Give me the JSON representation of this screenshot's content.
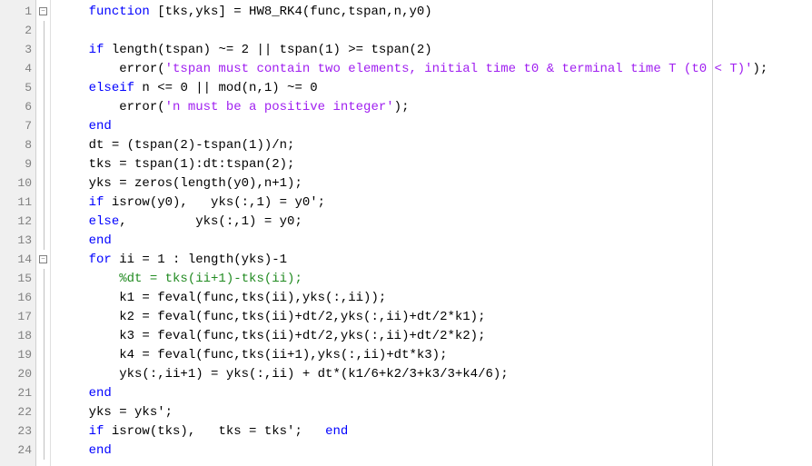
{
  "line_numbers": [
    "1",
    "2",
    "3",
    "4",
    "5",
    "6",
    "7",
    "8",
    "9",
    "10",
    "11",
    "12",
    "13",
    "14",
    "15",
    "16",
    "17",
    "18",
    "19",
    "20",
    "21",
    "22",
    "23",
    "24"
  ],
  "fold_markers": {
    "0": "minus",
    "13": "minus"
  },
  "code": [
    [
      {
        "c": "kw",
        "t": "function"
      },
      {
        "c": "txt",
        "t": " [tks,yks] = HW8_RK4(func,tspan,n,y0)"
      }
    ],
    [],
    [
      {
        "c": "kw",
        "t": "if"
      },
      {
        "c": "txt",
        "t": " length(tspan) ~= 2 || tspan(1) >= tspan(2)"
      }
    ],
    [
      {
        "c": "txt",
        "t": "    error("
      },
      {
        "c": "str",
        "t": "'tspan must contain two elements, initial time t0 & terminal time T (t0 < T)'"
      },
      {
        "c": "txt",
        "t": ");"
      }
    ],
    [
      {
        "c": "kw",
        "t": "elseif"
      },
      {
        "c": "txt",
        "t": " n <= 0 || mod(n,1) ~= 0"
      }
    ],
    [
      {
        "c": "txt",
        "t": "    error("
      },
      {
        "c": "str",
        "t": "'n must be a positive integer'"
      },
      {
        "c": "txt",
        "t": ");"
      }
    ],
    [
      {
        "c": "kw",
        "t": "end"
      }
    ],
    [
      {
        "c": "txt",
        "t": "dt = (tspan(2)-tspan(1))/n;"
      }
    ],
    [
      {
        "c": "txt",
        "t": "tks = tspan(1):dt:tspan(2);"
      }
    ],
    [
      {
        "c": "txt",
        "t": "yks = zeros(length(y0),n+1);"
      }
    ],
    [
      {
        "c": "kw",
        "t": "if"
      },
      {
        "c": "txt",
        "t": " isrow(y0),   yks(:,1) = y0';"
      }
    ],
    [
      {
        "c": "kw",
        "t": "else"
      },
      {
        "c": "txt",
        "t": ",         yks(:,1) = y0;"
      }
    ],
    [
      {
        "c": "kw",
        "t": "end"
      }
    ],
    [
      {
        "c": "kw",
        "t": "for"
      },
      {
        "c": "txt",
        "t": " ii = 1 : length(yks)-1"
      }
    ],
    [
      {
        "c": "txt",
        "t": "    "
      },
      {
        "c": "cmt",
        "t": "%dt = tks(ii+1)-tks(ii);"
      }
    ],
    [
      {
        "c": "txt",
        "t": "    k1 = feval(func,tks(ii),yks(:,ii));"
      }
    ],
    [
      {
        "c": "txt",
        "t": "    k2 = feval(func,tks(ii)+dt/2,yks(:,ii)+dt/2*k1);"
      }
    ],
    [
      {
        "c": "txt",
        "t": "    k3 = feval(func,tks(ii)+dt/2,yks(:,ii)+dt/2*k2);"
      }
    ],
    [
      {
        "c": "txt",
        "t": "    k4 = feval(func,tks(ii+1),yks(:,ii)+dt*k3);"
      }
    ],
    [
      {
        "c": "txt",
        "t": "    yks(:,ii+1) = yks(:,ii) + dt*(k1/6+k2/3+k3/3+k4/6);"
      }
    ],
    [
      {
        "c": "kw",
        "t": "end"
      }
    ],
    [
      {
        "c": "txt",
        "t": "yks = yks';"
      }
    ],
    [
      {
        "c": "kw",
        "t": "if"
      },
      {
        "c": "txt",
        "t": " isrow(tks),   tks = tks';   "
      },
      {
        "c": "kw",
        "t": "end"
      }
    ],
    [
      {
        "c": "kw",
        "t": "end"
      }
    ]
  ],
  "indent": "    "
}
